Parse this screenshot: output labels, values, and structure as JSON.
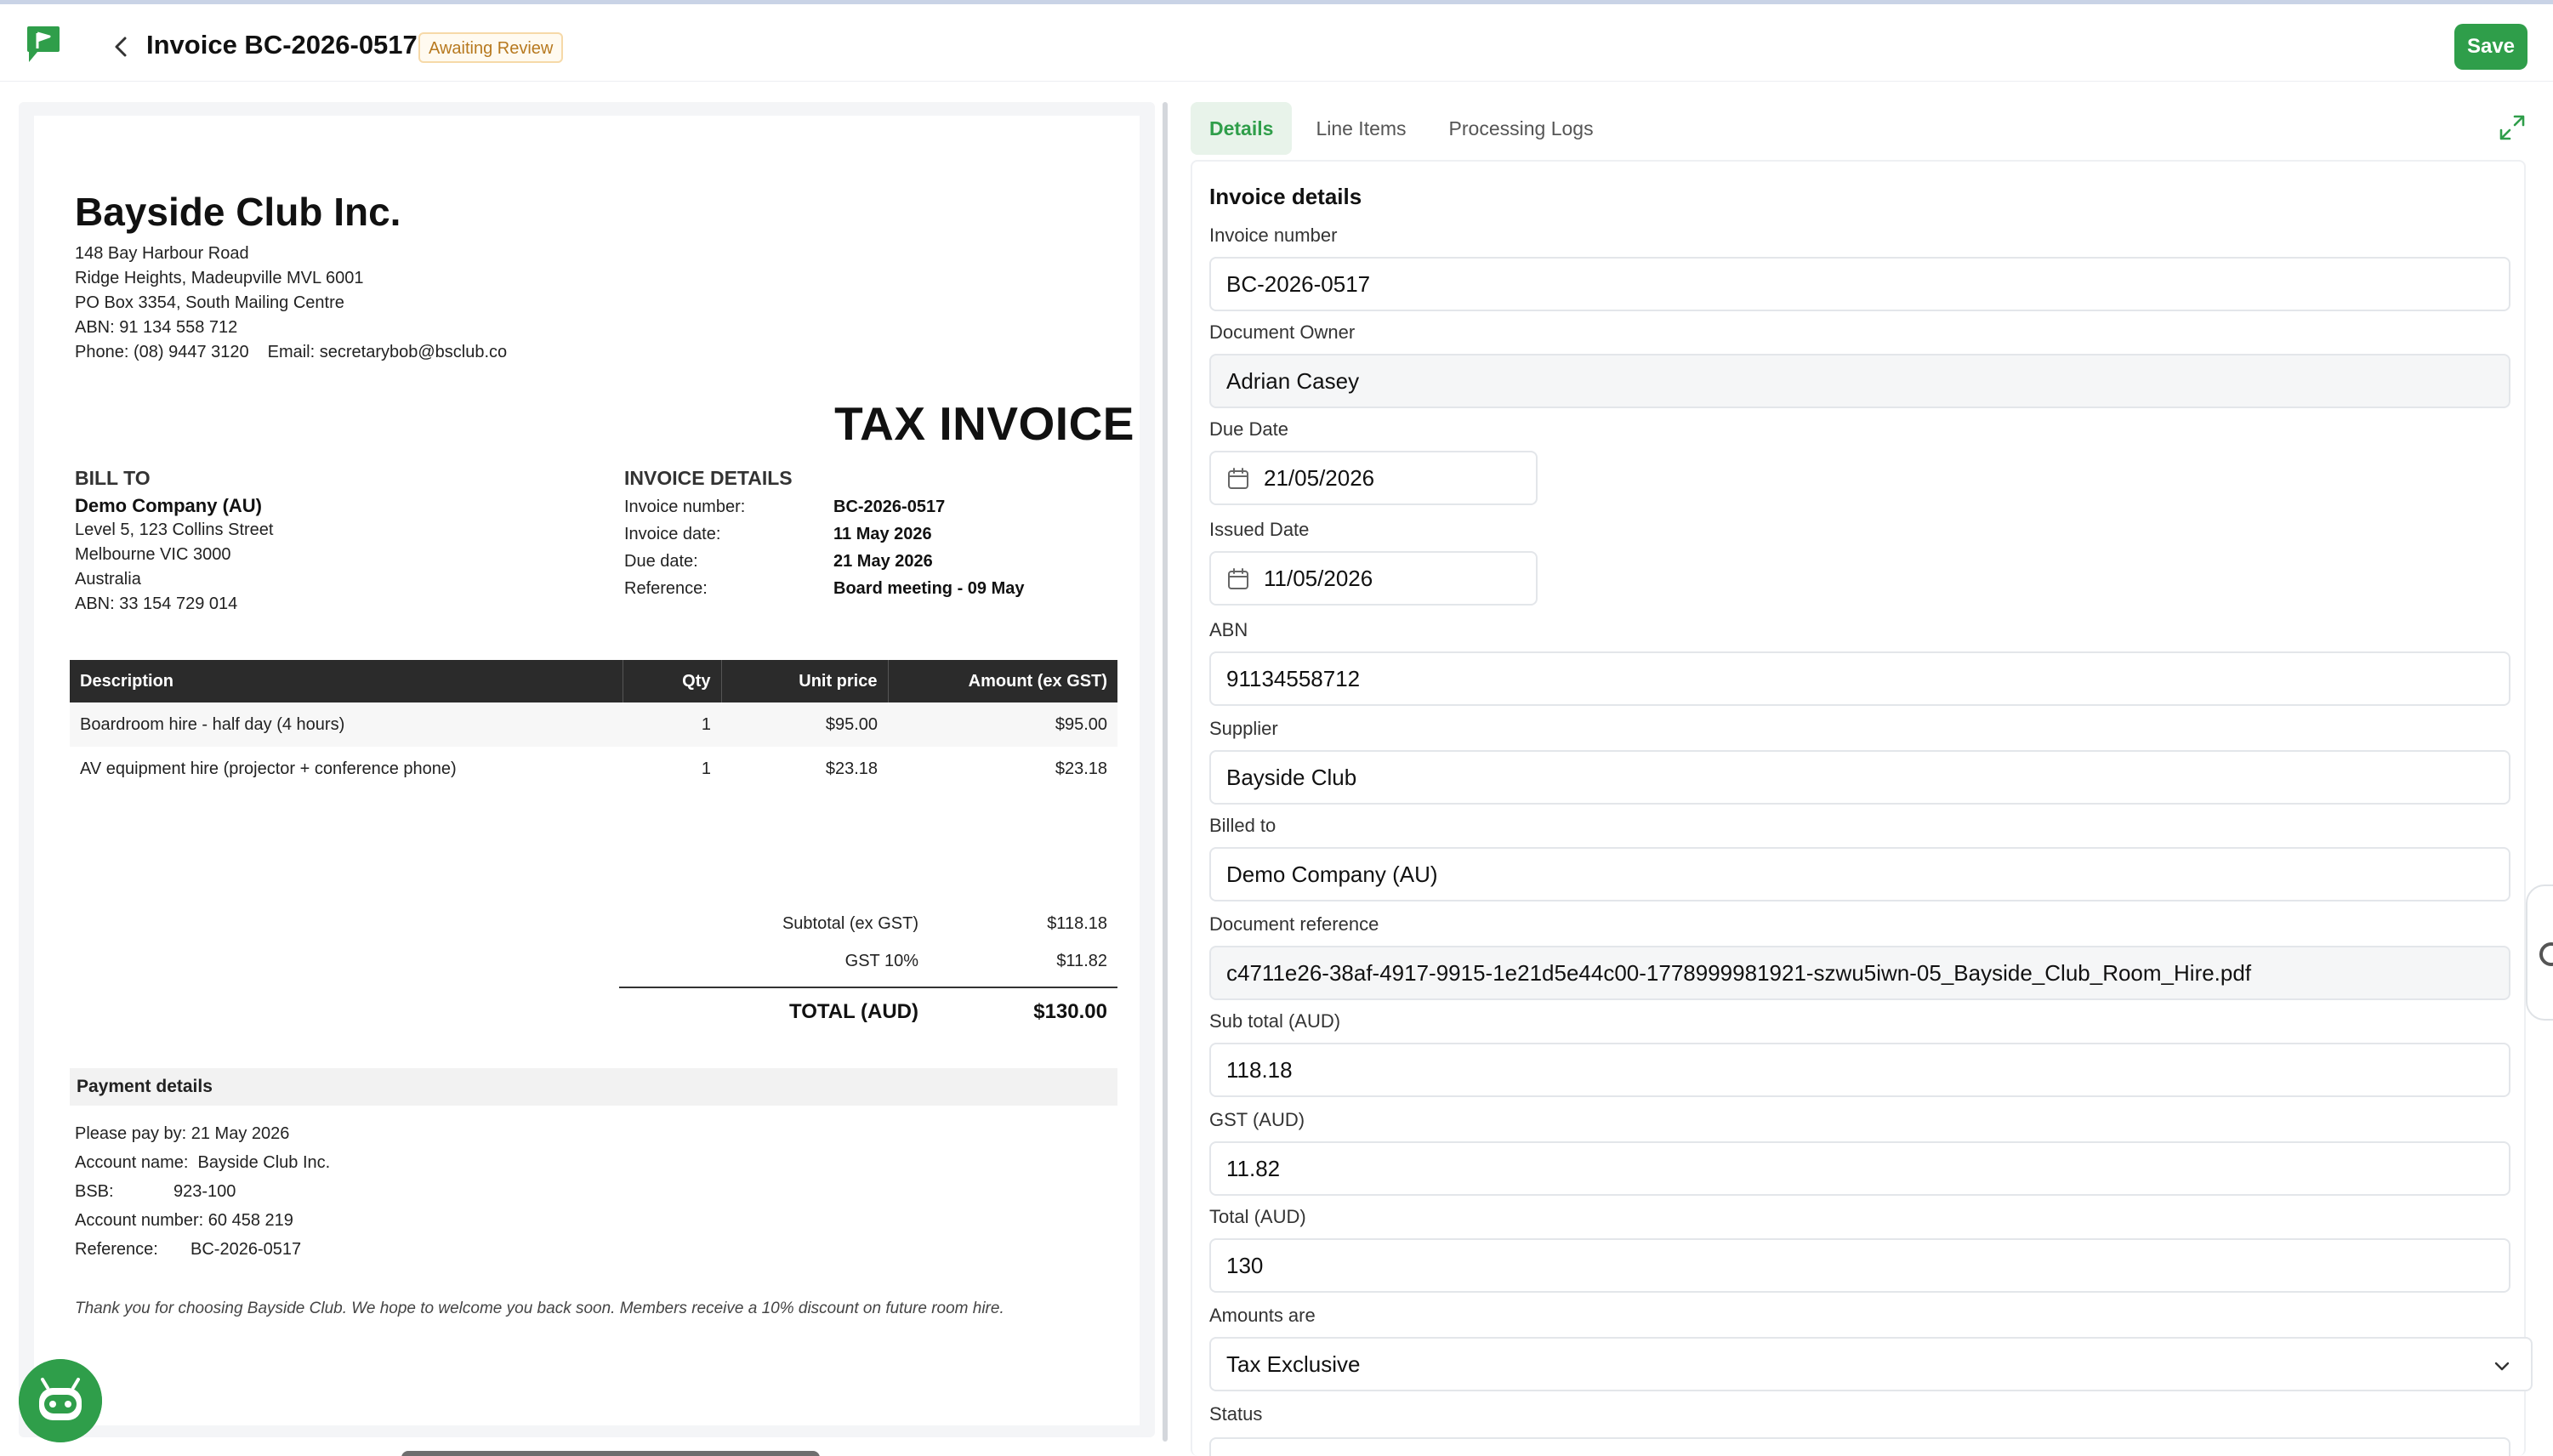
{
  "header": {
    "title": "Invoice BC-2026-0517",
    "status": "Awaiting Review",
    "save_label": "Save"
  },
  "invoice_doc": {
    "supplier_name": "Bayside Club Inc.",
    "address_1": "148 Bay Harbour Road",
    "address_2": "Ridge Heights, Madeupville MVL 6001",
    "address_3": "PO Box 3354, South Mailing Centre",
    "abn": "ABN: 91 134 558 712",
    "phone": "Phone: (08) 9447 3120",
    "email": "Email: secretarybob@bsclub.co",
    "doc_title": "TAX INVOICE",
    "bill_to": {
      "heading": "BILL TO",
      "company": "Demo Company (AU)",
      "line_1": "Level 5, 123 Collins Street",
      "line_2": "Melbourne VIC 3000",
      "line_3": "Australia",
      "abn": "ABN: 33 154 729 014"
    },
    "details": {
      "heading": "INVOICE DETAILS",
      "rows": [
        {
          "k": "Invoice number:",
          "v": "BC-2026-0517"
        },
        {
          "k": "Invoice date:",
          "v": "11 May 2026"
        },
        {
          "k": "Due date:",
          "v": "21 May 2026"
        },
        {
          "k": "Reference:",
          "v": "Board meeting - 09 May"
        }
      ]
    },
    "table": {
      "headers": [
        "Description",
        "Qty",
        "Unit price",
        "Amount (ex GST)"
      ],
      "rows": [
        [
          "Boardroom hire - half day (4 hours)",
          "1",
          "$95.00",
          "$95.00"
        ],
        [
          "AV equipment hire (projector + conference phone)",
          "1",
          "$23.18",
          "$23.18"
        ]
      ]
    },
    "totals": {
      "subtotal_label": "Subtotal (ex GST)",
      "subtotal": "$118.18",
      "gst_label": "GST 10%",
      "gst": "$11.82",
      "total_label": "TOTAL (AUD)",
      "total": "$130.00"
    },
    "payment": {
      "heading": "Payment details",
      "pay_by": "Please pay by: 21 May 2026",
      "account_name_label": "Account name:",
      "account_name": "Bayside Club Inc.",
      "bsb_label": "BSB:",
      "bsb": "923-100",
      "account_number_label": "Account number:",
      "account_number": "60 458 219",
      "reference_label": "Reference:",
      "reference": "BC-2026-0517"
    },
    "thanks": "Thank you for choosing Bayside Club. We hope to welcome you back soon. Members receive a 10% discount on future room hire."
  },
  "viewer_toolbar": {
    "icons": [
      "zoom-out-icon",
      "zoom-in-icon",
      "fit-screen-icon",
      "document-icon",
      "download-icon",
      "previous-page-icon",
      "next-page-icon"
    ]
  },
  "tabs": [
    "Details",
    "Line Items",
    "Processing Logs"
  ],
  "form": {
    "heading": "Invoice details",
    "invoice_number_label": "Invoice number",
    "invoice_number": "BC-2026-0517",
    "document_owner_label": "Document Owner",
    "document_owner": "Adrian Casey",
    "due_date_label": "Due Date",
    "due_date": "21/05/2026",
    "issued_date_label": "Issued Date",
    "issued_date": "11/05/2026",
    "abn_label": "ABN",
    "abn": "91134558712",
    "supplier_label": "Supplier",
    "supplier": "Bayside Club",
    "billed_to_label": "Billed to",
    "billed_to": "Demo Company (AU)",
    "doc_ref_label": "Document reference",
    "doc_ref": "c4711e26-38af-4917-9915-1e21d5e44c00-1778999981921-szwu5iwn-05_Bayside_Club_Room_Hire.pdf",
    "subtotal_label": "Sub total (AUD)",
    "subtotal": "118.18",
    "gst_label": "GST (AUD)",
    "gst": "11.82",
    "total_label": "Total (AUD)",
    "total": "130",
    "amounts_are_label": "Amounts are",
    "amounts_are": "Tax Exclusive",
    "status_label": "Status"
  },
  "colors": {
    "accent": "#2f9e4a",
    "badge_text": "#b7791f",
    "table_header": "#2b2b2b"
  }
}
